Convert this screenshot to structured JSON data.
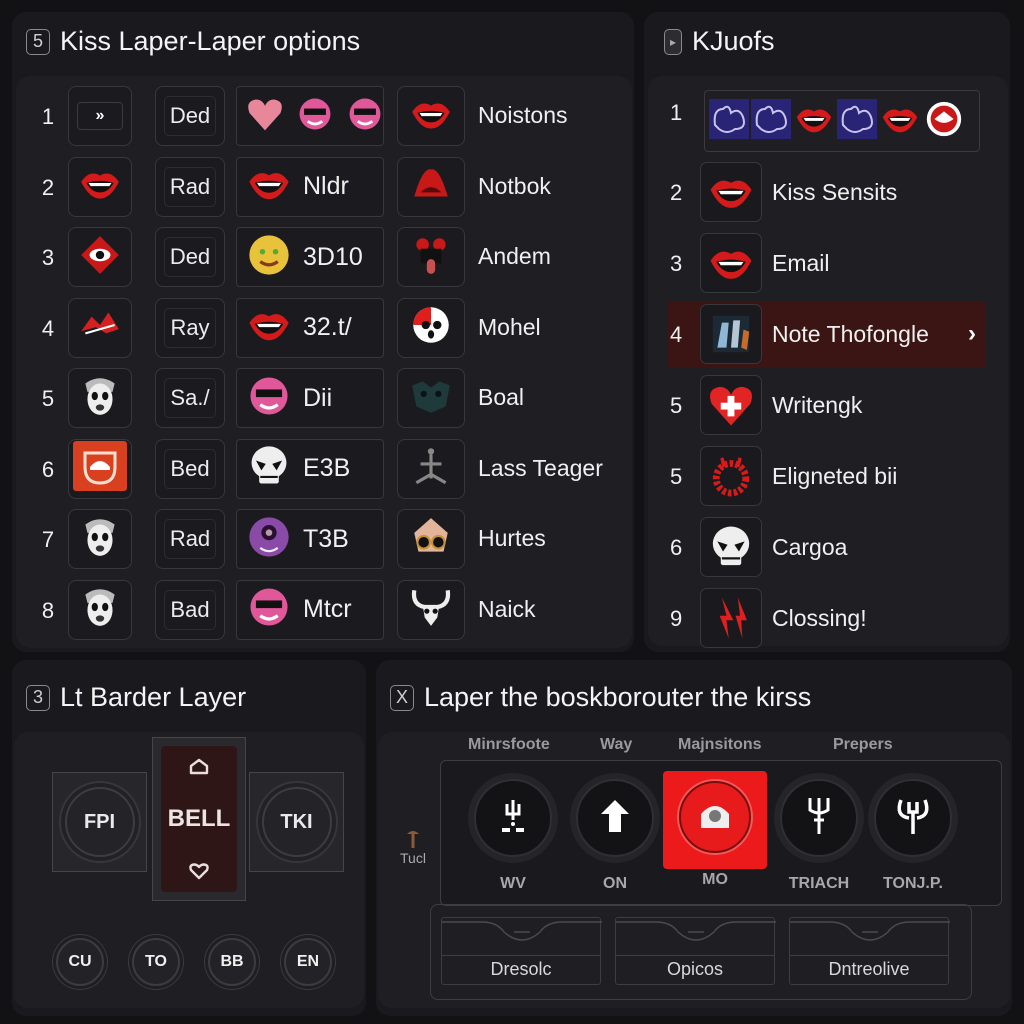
{
  "options_panel": {
    "badge": "5",
    "title": "Kiss Laper-Laper options",
    "rows": [
      {
        "num": "1",
        "icon": "skip-forward-icon",
        "label": "Ded",
        "combo_text": "",
        "combo_icons": [
          "heart-icon",
          "pink-mask-icon",
          "pink-monster-icon"
        ],
        "right_icon": "lips-icon",
        "name": "Noistons"
      },
      {
        "num": "2",
        "icon": "red-lips-icon",
        "label": "Rad",
        "combo_text": "Nldr",
        "combo_icons": [
          "open-lips-icon"
        ],
        "right_icon": "lips-shout-icon",
        "name": "Notbok"
      },
      {
        "num": "3",
        "icon": "eye-lips-icon",
        "label": "Ded",
        "combo_text": "3D10",
        "combo_icons": [
          "yellow-face-icon"
        ],
        "right_icon": "tongue-face-icon",
        "name": "Andem"
      },
      {
        "num": "4",
        "icon": "red-graffiti-icon",
        "label": "Ray",
        "combo_text": "32.t/",
        "combo_icons": [
          "heart-lips-icon"
        ],
        "right_icon": "panda-face-icon",
        "name": "Mohel"
      },
      {
        "num": "5",
        "icon": "white-face-icon",
        "label": "Sa./",
        "combo_text": "Dii",
        "combo_icons": [
          "pink-sunglasses-icon"
        ],
        "right_icon": "dark-mask-icon",
        "name": "Boal"
      },
      {
        "num": "6",
        "icon": "orange-helmet-icon",
        "label": "Bed",
        "combo_text": "E3B",
        "combo_icons": [
          "skull-icon"
        ],
        "right_icon": "anchor-figure-icon",
        "name": "Lass Teager"
      },
      {
        "num": "7",
        "icon": "clown-face-icon",
        "label": "Rad",
        "combo_text": "T3B",
        "combo_icons": [
          "purple-creature-icon"
        ],
        "right_icon": "tan-skull-icon",
        "name": "Hurtes"
      },
      {
        "num": "8",
        "icon": "scream-mask-icon",
        "label": "Bad",
        "combo_text": "Mtcr",
        "combo_icons": [
          "pink-beast-icon"
        ],
        "right_icon": "horned-skull-icon",
        "name": "Naick"
      }
    ]
  },
  "list_panel": {
    "title": "KJuofs",
    "strip_icons": [
      "blue-flower-icon",
      "blue-flower-icon",
      "lips-icon",
      "blue-flower-icon",
      "lips-icon",
      "lips-ring-icon"
    ],
    "strip_num": "1",
    "items": [
      {
        "num": "2",
        "icon": "fanged-lips-icon",
        "label": "Kiss Sensits",
        "selected": false
      },
      {
        "num": "3",
        "icon": "teeth-lips-icon",
        "label": "Email",
        "selected": false
      },
      {
        "num": "4",
        "icon": "robot-mech-icon",
        "label": "Note Thofongle",
        "selected": true
      },
      {
        "num": "5",
        "icon": "heart-plus-icon",
        "label": "Writengk",
        "selected": false
      },
      {
        "num": "5",
        "icon": "red-ring-icon",
        "label": "Eligneted bii",
        "selected": false
      },
      {
        "num": "6",
        "icon": "skull-icon",
        "label": "Cargoa",
        "selected": false
      },
      {
        "num": "9",
        "icon": "lightning-icon",
        "label": "Clossing!",
        "selected": false
      }
    ]
  },
  "border_panel": {
    "badge": "3",
    "title": "Lt Barder Layer",
    "left_tile": "FPI",
    "right_tile": "TKI",
    "center_button": "BELL",
    "round_buttons": [
      "CU",
      "TO",
      "BB",
      "EN"
    ]
  },
  "router_panel": {
    "badge": "X",
    "title": "Laper the boskborouter the kirss",
    "column_headers": [
      "Minrsfoote",
      "Way",
      "Majnsitons",
      "Prepers"
    ],
    "side_tool_label": "Tucl",
    "knobs": [
      {
        "label": "WV",
        "icon": "trident-figure-icon",
        "active": false
      },
      {
        "label": "ON",
        "icon": "arrow-up-icon",
        "active": false
      },
      {
        "label": "MO",
        "icon": "helmet-icon",
        "active": true
      },
      {
        "label": "TRIACH",
        "icon": "trident-icon",
        "active": false
      },
      {
        "label": "TONJ.P.",
        "icon": "horned-staff-icon",
        "active": false
      }
    ],
    "presets": [
      "Dresolc",
      "Opicos",
      "Dntreolive"
    ]
  },
  "colors": {
    "accent_red": "#ec1a1a",
    "selected_row": "#3b1414",
    "background": "#121215"
  }
}
